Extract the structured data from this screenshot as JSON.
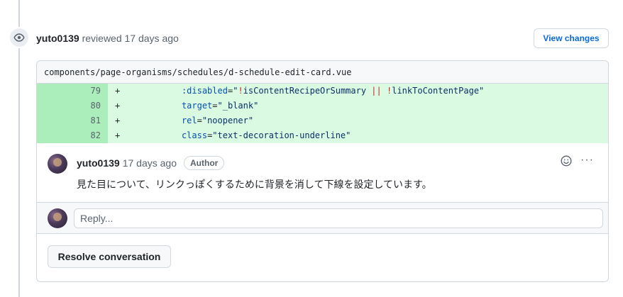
{
  "review": {
    "user": "yuto0139",
    "action": "reviewed",
    "time": "17 days ago",
    "view_changes_label": "View changes"
  },
  "file": {
    "path": "components/page-organisms/schedules/d-schedule-edit-card.vue"
  },
  "diff_lines": [
    {
      "num": "79",
      "sign": "+",
      "attr": ":disabled",
      "eq": "=",
      "q1": "\"",
      "op1": "!",
      "v1": "isContentRecipeOrSummary ",
      "op2": "||",
      "sp": " ",
      "op3": "!",
      "v2": "linkToContentPage",
      "q2": "\""
    },
    {
      "num": "80",
      "sign": "+",
      "attr": "target",
      "eq": "=",
      "value": "\"_blank\""
    },
    {
      "num": "81",
      "sign": "+",
      "attr": "rel",
      "eq": "=",
      "value": "\"noopener\""
    },
    {
      "num": "82",
      "sign": "+",
      "attr": "class",
      "eq": "=",
      "value": "\"text-decoration-underline\""
    }
  ],
  "comment": {
    "user": "yuto0139",
    "time": "17 days ago",
    "badge": "Author",
    "body": "見た目について、リンクっぽくするために背景を消して下線を設定しています。",
    "more_glyph": "···"
  },
  "reply": {
    "placeholder": "Reply..."
  },
  "resolve": {
    "label": "Resolve conversation"
  },
  "colors": {
    "link": "#0969da",
    "added_line_bg": "#dafbe1",
    "added_num_bg": "#aceebb"
  }
}
